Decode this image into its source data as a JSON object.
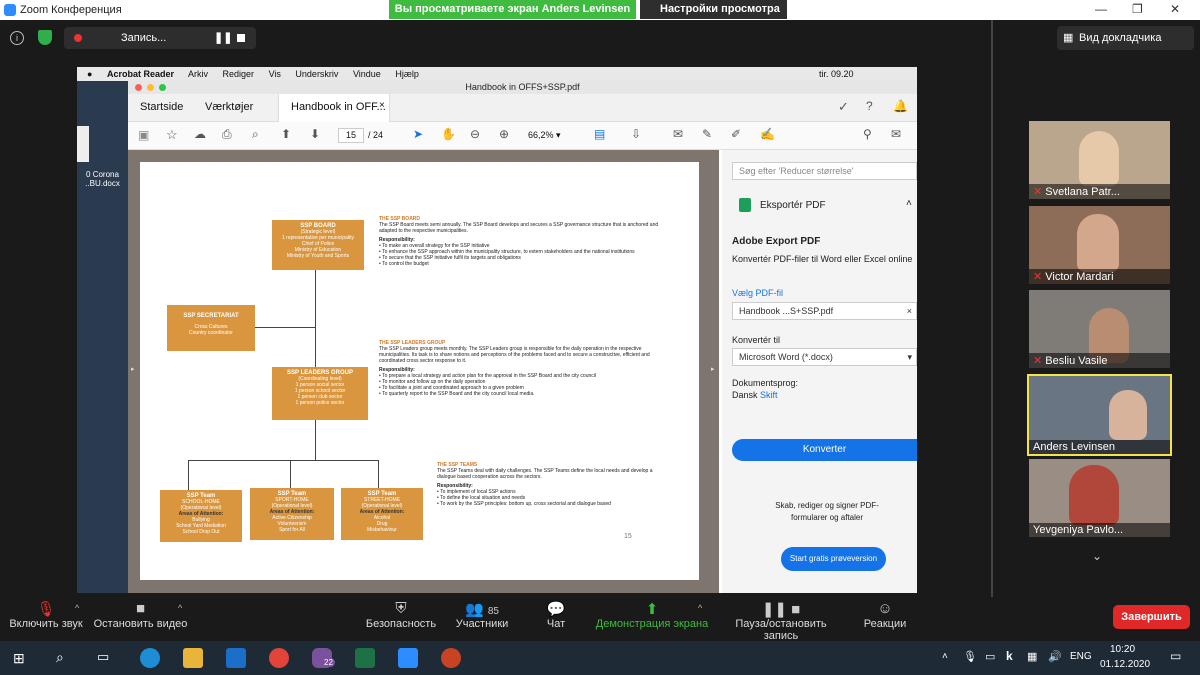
{
  "zoom": {
    "window_title": "Zoom Конференция",
    "share_banner": "Вы просматриваете экран Anders Levinsen",
    "view_options": "Настройки просмотра",
    "recording": "Запись...",
    "speaker_view": "Вид докладчика"
  },
  "mac_menu": [
    "Acrobat Reader",
    "Arkiv",
    "Rediger",
    "Vis",
    "Underskriv",
    "Vindue",
    "Hjælp"
  ],
  "mac_clock": "tir. 09.20",
  "acrobat": {
    "title": "Handbook in OFFS+SSP.pdf",
    "tabs": [
      "Startside",
      "Værktøjer",
      "Handbook in OFF..."
    ],
    "page_current": "15",
    "page_total": "/ 24",
    "zoom": "66,2%",
    "search_placeholder": "Søg efter 'Reducer størrelse'",
    "export_header": "Eksportér PDF",
    "export_title": "Adobe Export PDF",
    "export_desc": "Konvertér PDF-filer til Word eller Excel online",
    "choose_pdf_label": "Vælg PDF-fil",
    "choose_pdf_value": "Handbook ...S+SSP.pdf",
    "convert_to_label": "Konvertér til",
    "convert_to_value": "Microsoft Word (*.docx)",
    "doc_lang_label": "Dokumentsprog:",
    "doc_lang_value": "Dansk",
    "doc_lang_change": "Skift",
    "convert_button": "Konverter",
    "promo_text": "Skab, rediger og signer PDF-formularer og aftaler",
    "trial_button": "Start gratis prøveversion"
  },
  "desktop_file": [
    "0 Corona",
    "..BU.docx"
  ],
  "pdf": {
    "page_number": "15",
    "board_box": {
      "title": "SSP BOARD",
      "sub": "(Strategic level)",
      "lines": [
        "1 representative per municipality",
        "Chief of Police",
        "Ministry of Education",
        "Ministry of Youth and Sports"
      ]
    },
    "secretariat_box": {
      "title": "SSP SECRETARIAT",
      "lines": [
        "Cross Cultures",
        "Country coordinator"
      ]
    },
    "leaders_box": {
      "title": "SSP LEADERS GROUP",
      "sub": "(Coordinating level)",
      "lines": [
        "1 person social sector",
        "1 person school sector",
        "1 person club sector",
        "1 person police sector"
      ]
    },
    "teams": [
      {
        "title": "SSP Team",
        "name": "SCHOOL-HOME",
        "sub": "(Operational level)",
        "area": "Areas of Attention:",
        "lines": [
          "Bullying",
          "School Yard Mediation",
          "School Drop Out"
        ]
      },
      {
        "title": "SSP Team",
        "name": "SPORT-HOME",
        "sub": "(Operational level)",
        "area": "Areas of Attention:",
        "lines": [
          "Active Citizenship",
          "Volunteerism",
          "Sport for All"
        ]
      },
      {
        "title": "SSP Team",
        "name": "STREET-HOME",
        "sub": "(Operational level)",
        "area": "Areas of Attention:",
        "lines": [
          "Alcohol",
          "Drug",
          "Misbehaviour"
        ]
      }
    ],
    "board_text": {
      "heading": "THE SSP BOARD",
      "body": "The SSP Board meets semi annually. The SSP Board develops and secures a SSP governance structure that is anchored and adapted to the respective municipalities.",
      "resp": "Responsibility:",
      "items": [
        "To make an overall strategy for the SSP initiative",
        "To enhance the SSP approach within the municipality structure, to extern stakeholders and the national institutions",
        "To secure that the SSP initiative fulfil its targets and obligations",
        "To control the budget"
      ]
    },
    "leaders_text": {
      "heading": "THE SSP LEADERS GROUP",
      "body": "The SSP Leaders group meets monthly. The SSP Leaders group is responsible for the daily operation in the respective municipalities. Its task is to share notions and perceptions of the problems faced and to secure a constructive, efficient and coordinated cross sector response to it.",
      "resp": "Responsibility:",
      "items": [
        "To prepare a local strategy and action plan for the approval in the SSP Board and the city council",
        "To monitor and follow up on the daily operation",
        "To facilitate a joint and coordinated approach to a given problem",
        "To quarterly report to the SSP Board and the city council local media."
      ]
    },
    "teams_text": {
      "heading": "THE SSP TEAMS",
      "body": "The SSP Teams deal with daily challenges. The SSP Teams define the local needs and develop a dialogue based cooperation across the sectors.",
      "resp": "Responsibility:",
      "items": [
        "To implement of local SSP actions",
        "To define the local situation and needs",
        "To work by the SSP principles: bottom up, cross sectorial and dialogue based"
      ]
    }
  },
  "participants": [
    {
      "name": "Svetlana Patr...",
      "muted": true,
      "bg": "#b9a68c"
    },
    {
      "name": "Victor Mardari",
      "muted": true,
      "bg": "#8d6c58"
    },
    {
      "name": "Besliu Vasile",
      "muted": true,
      "bg": "#7f7c78"
    },
    {
      "name": "Anders Levinsen",
      "muted": false,
      "bg": "#6a7583"
    },
    {
      "name": "Yevgeniya Pavlo...",
      "muted": false,
      "bg": "#9a8d84"
    }
  ],
  "bottom": {
    "mute": "Включить звук",
    "video": "Остановить видео",
    "security": "Безопасность",
    "participants": "Участники",
    "participants_count": "85",
    "chat": "Чат",
    "share": "Демонстрация экрана",
    "pause_rec": "Пауза/остановить запись",
    "reactions": "Реакции",
    "end": "Завершить"
  },
  "taskbar": {
    "lang": "ENG",
    "time": "10:20",
    "date": "01.12.2020",
    "viber_badge": "22"
  },
  "colors": {
    "share_green": "#3fbb3f",
    "end_red": "#e02828",
    "org_orange": "#d9963f",
    "acrobat_blue": "#1473e6",
    "active_speaker": "#f4e44a"
  }
}
